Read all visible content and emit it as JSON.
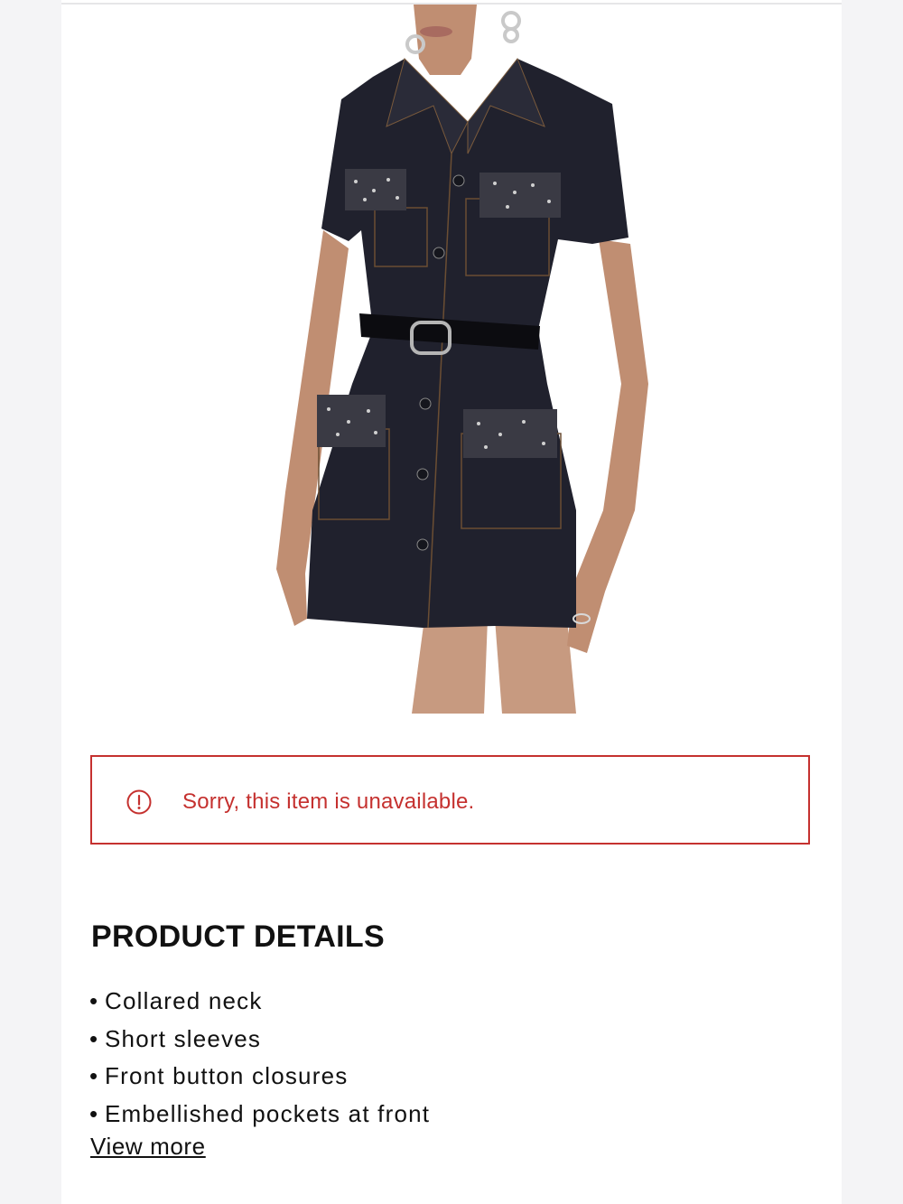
{
  "product": {
    "image_icon": "dress-photo"
  },
  "alert": {
    "icon": "alert-circle-icon",
    "message": "Sorry, this item is unavailable.",
    "color": "#c5312f"
  },
  "details": {
    "title": "PRODUCT DETAILS",
    "items": [
      "Collared neck",
      "Short sleeves",
      "Front button closures",
      "Embellished pockets at front"
    ],
    "bullet": "•",
    "view_more_label": "View more"
  }
}
